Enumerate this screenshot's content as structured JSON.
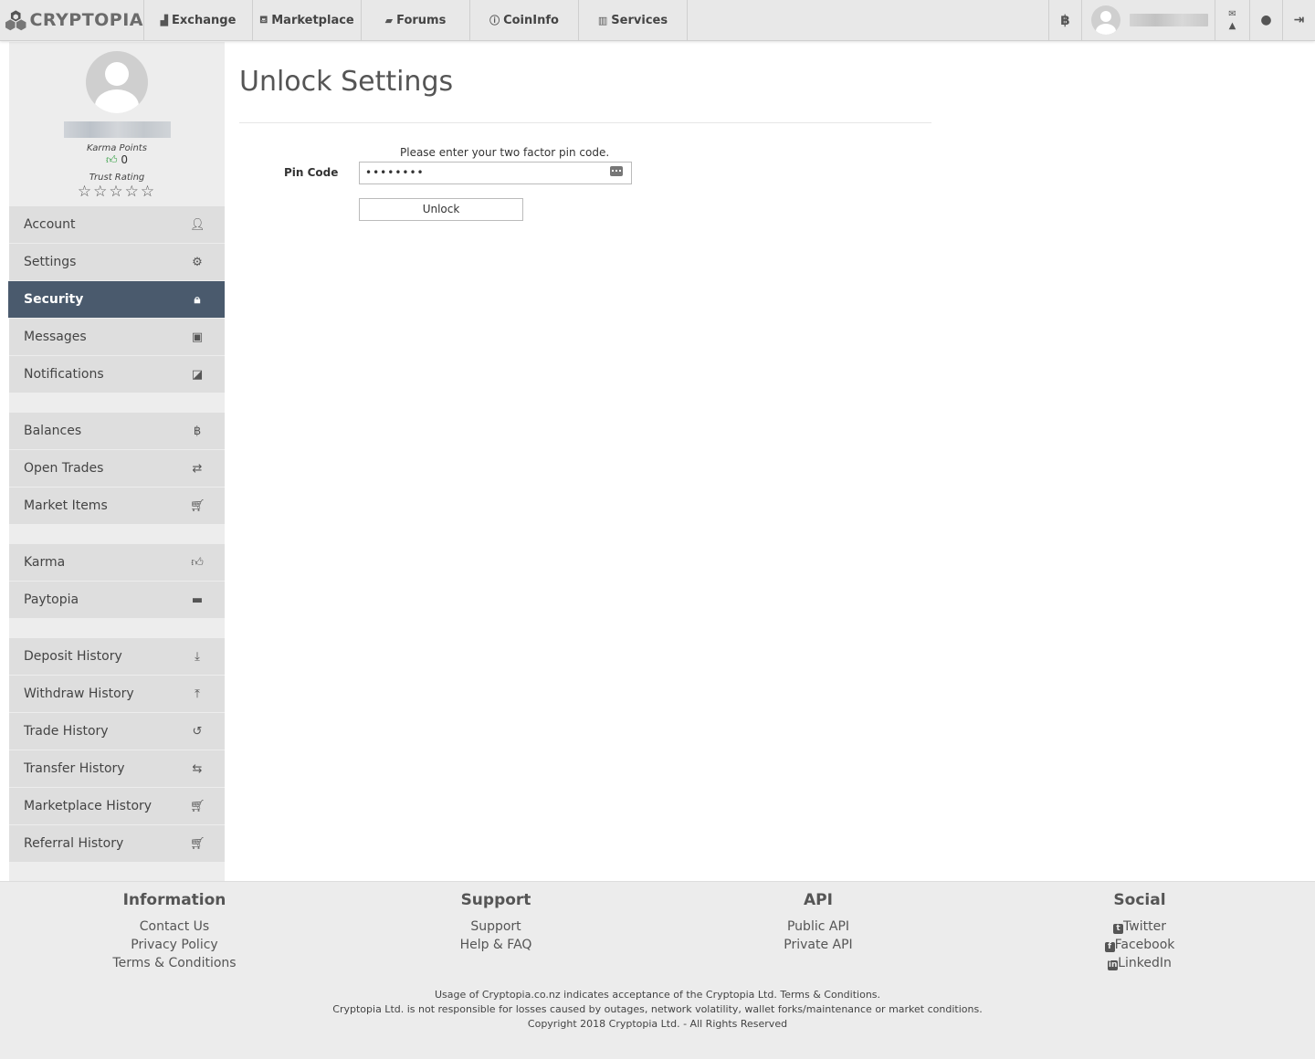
{
  "brand": {
    "name": "CRYPTOPIA"
  },
  "nav": {
    "items": [
      {
        "label": "Exchange",
        "icon": "bar-chart-icon"
      },
      {
        "label": "Marketplace",
        "icon": "basket-icon"
      },
      {
        "label": "Forums",
        "icon": "comments-icon"
      },
      {
        "label": "CoinInfo",
        "icon": "info-icon"
      },
      {
        "label": "Services",
        "icon": "bank-icon"
      }
    ],
    "right": {
      "currency_symbol": "฿"
    }
  },
  "profile": {
    "karma_label": "Karma Points",
    "karma_value": "0",
    "trust_label": "Trust Rating",
    "stars": "☆☆☆☆☆",
    "trust_rating": 0
  },
  "sidebar": {
    "group1": [
      {
        "label": "Account",
        "icon": "user-icon"
      },
      {
        "label": "Settings",
        "icon": "gear-icon"
      },
      {
        "label": "Security",
        "icon": "lock-icon",
        "active": true
      },
      {
        "label": "Messages",
        "icon": "inbox-icon"
      },
      {
        "label": "Notifications",
        "icon": "bell-icon"
      }
    ],
    "group2": [
      {
        "label": "Balances",
        "icon": "bitcoin-icon"
      },
      {
        "label": "Open Trades",
        "icon": "exchange-icon"
      },
      {
        "label": "Market Items",
        "icon": "cart-icon"
      }
    ],
    "group3": [
      {
        "label": "Karma",
        "icon": "thumbs-up-icon"
      },
      {
        "label": "Paytopia",
        "icon": "card-icon"
      }
    ],
    "group4": [
      {
        "label": "Deposit History",
        "icon": "download-icon"
      },
      {
        "label": "Withdraw History",
        "icon": "upload-icon"
      },
      {
        "label": "Trade History",
        "icon": "history-icon"
      },
      {
        "label": "Transfer History",
        "icon": "transfer-icon"
      },
      {
        "label": "Marketplace History",
        "icon": "cart-icon"
      },
      {
        "label": "Referral History",
        "icon": "cart-icon"
      }
    ]
  },
  "main": {
    "title": "Unlock Settings",
    "hint": "Please enter your two factor pin code.",
    "pin_label": "Pin Code",
    "pin_value": "••••••••",
    "unlock_label": "Unlock"
  },
  "footer": {
    "information": {
      "title": "Information",
      "links": [
        "Contact Us",
        "Privacy Policy",
        "Terms & Conditions"
      ]
    },
    "support": {
      "title": "Support",
      "links": [
        "Support",
        "Help & FAQ"
      ]
    },
    "api": {
      "title": "API",
      "links": [
        "Public API",
        "Private API"
      ]
    },
    "social": {
      "title": "Social",
      "links": [
        "Twitter",
        "Facebook",
        "LinkedIn"
      ]
    },
    "notes": [
      "Usage of Cryptopia.co.nz indicates acceptance of the Cryptopia Ltd. Terms & Conditions.",
      "Cryptopia Ltd. is not responsible for losses caused by outages, network volatility, wallet forks/maintenance or market conditions.",
      "Copyright 2018 Cryptopia Ltd. - All Rights Reserved"
    ]
  },
  "colors": {
    "active_menu": "#4a5a6d",
    "karma_thumb": "#2a9b3a",
    "sidebar_bg": "#ededed",
    "footer_bg": "#ececec"
  }
}
